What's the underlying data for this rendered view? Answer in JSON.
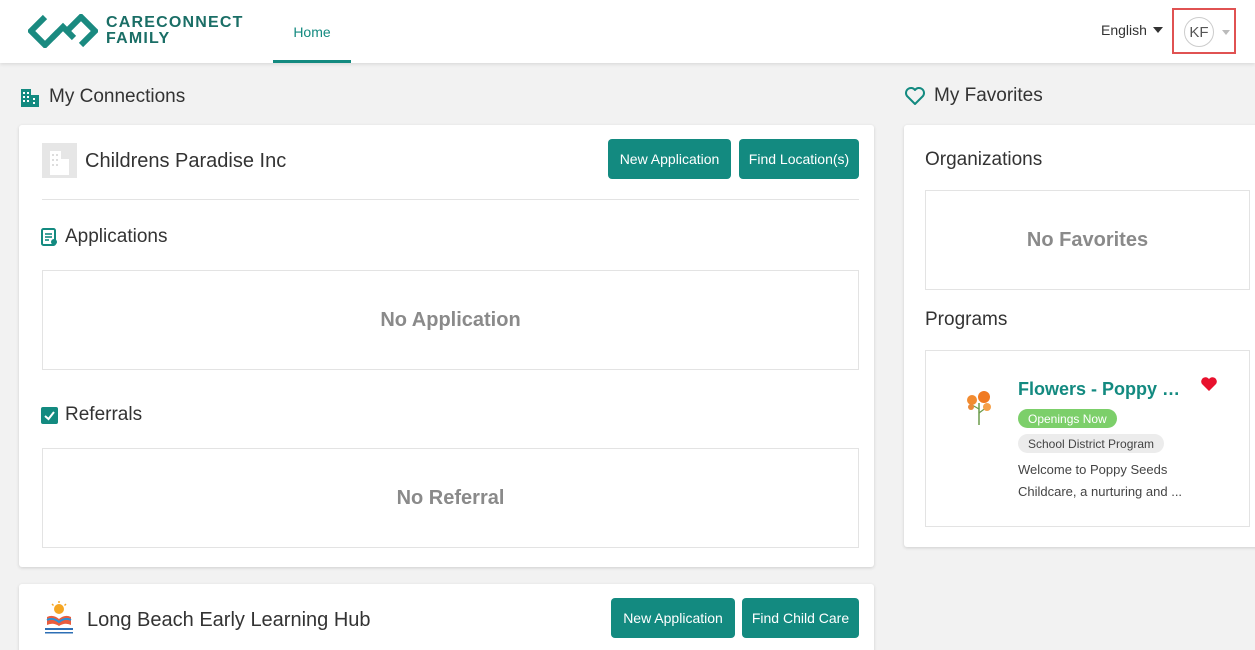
{
  "header": {
    "logo_line1": "CARECONNECT",
    "logo_line2": "FAMILY",
    "nav_home": "Home",
    "language": "English",
    "user_initials": "KF"
  },
  "connections": {
    "title": "My Connections",
    "orgs": [
      {
        "name": "Childrens Paradise Inc",
        "new_application_label": "New Application",
        "find_label": "Find Location(s)",
        "applications_title": "Applications",
        "applications_empty": "No Application",
        "referrals_title": "Referrals",
        "referrals_empty": "No Referral"
      },
      {
        "name": "Long Beach Early Learning Hub",
        "new_application_label": "New Application",
        "find_label": "Find Child Care"
      }
    ]
  },
  "favorites": {
    "title": "My Favorites",
    "organizations_title": "Organizations",
    "organizations_empty": "No Favorites",
    "programs_title": "Programs",
    "programs": [
      {
        "name": "Flowers - Poppy Seeds Childcare",
        "status_badge": "Openings Now",
        "type_badge": "School District Program",
        "description": "Welcome to Poppy Seeds Childcare, a nurturing and ..."
      }
    ]
  },
  "colors": {
    "brand": "#138a80",
    "favorite_heart": "#e8112d",
    "openings_badge": "#7ccf6a"
  }
}
